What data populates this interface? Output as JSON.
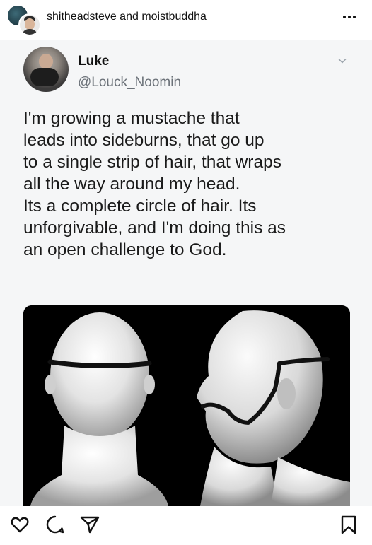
{
  "post": {
    "usernames": "shitheadsteve and moistbuddha",
    "more_icon": "more-horizontal-icon"
  },
  "tweet": {
    "display_name": "Luke",
    "handle": "@Louck_Noomin",
    "text": "I'm growing a mustache that\nleads into sideburns, that go up\nto a single strip of hair, that wraps\nall the way around my head.\nIts a complete circle of hair. Its\nunforgivable, and I'm doing this as\nan open challenge to God.",
    "menu_icon": "chevron-down-icon"
  },
  "media": {
    "description_icon": "mannequin-heads-image"
  },
  "actions": {
    "icons": [
      "heart-icon",
      "comment-icon",
      "share-icon",
      "bookmark-icon"
    ]
  },
  "colors": {
    "tweet_background": "#f5f6f7",
    "handle_gray": "#6b7178",
    "text": "#1a1a1a"
  }
}
